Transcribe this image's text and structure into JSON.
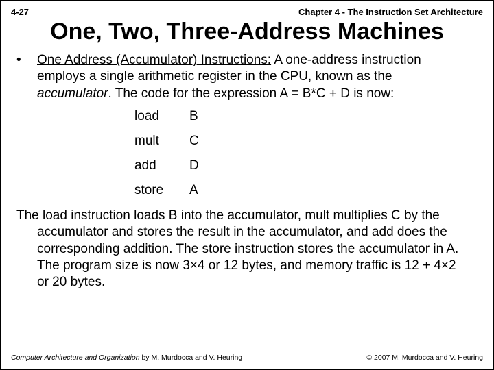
{
  "header": {
    "page_number": "4-27",
    "chapter": "Chapter 4 - The Instruction Set Architecture"
  },
  "title": "One, Two, Three-Address Machines",
  "bullet": {
    "lead": "One Address (Accumulator) Instructions:",
    "rest1": " A one-address instruction",
    "line2": "employs a single arithmetic register in the CPU, known as the",
    "line3a": "accumulator",
    "line3b": ". The code for the expression A = B*C + D is now:"
  },
  "code": [
    {
      "op": "load",
      "arg": "B"
    },
    {
      "op": "mult",
      "arg": "C"
    },
    {
      "op": "add",
      "arg": "D"
    },
    {
      "op": "store",
      "arg": "A"
    }
  ],
  "explain": {
    "line1": "The load instruction loads B into the accumulator, mult multiplies C by the",
    "line2": "accumulator and stores the result in the accumulator, and add does the",
    "line3": "corresponding addition. The store instruction stores the accumulator in A.",
    "line4": "The program size is now 3×4 or 12 bytes, and memory traffic is 12 + 4×2",
    "line5": "or 20 bytes."
  },
  "footer": {
    "book_title": "Computer Architecture and Organization",
    "authors": " by M. Murdocca and V. Heuring",
    "copyright": "© 2007 M. Murdocca and V. Heuring"
  }
}
